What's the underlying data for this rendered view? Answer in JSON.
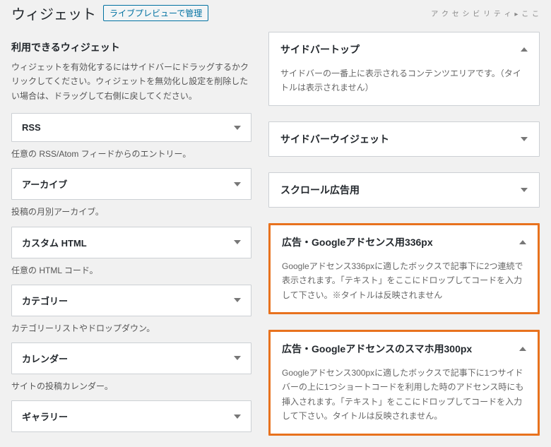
{
  "header": {
    "title": "ウィジェット",
    "manage_button": "ライブプレビューで管理",
    "top_right": "ア ク セ シ ビ リ テ ィ  ▸  こ こ"
  },
  "left": {
    "heading": "利用できるウィジェット",
    "help": "ウィジェットを有効化するにはサイドバーにドラッグするかクリックしてください。ウィジェットを無効化し設定を削除したい場合は、ドラッグして右側に戻してください。",
    "widgets": [
      {
        "title": "RSS",
        "desc": "任意の RSS/Atom フィードからのエントリー。"
      },
      {
        "title": "アーカイブ",
        "desc": "投稿の月別アーカイブ。"
      },
      {
        "title": "カスタム HTML",
        "desc": "任意の HTML コード。"
      },
      {
        "title": "カテゴリー",
        "desc": "カテゴリーリストやドロップダウン。"
      },
      {
        "title": "カレンダー",
        "desc": "サイトの投稿カレンダー。"
      },
      {
        "title": "ギャラリー",
        "desc": ""
      }
    ]
  },
  "right": {
    "areas": [
      {
        "title": "サイドバートップ",
        "arrow": "up",
        "body": "サイドバーの一番上に表示されるコンテンツエリアです。（タイトルは表示されません）",
        "highlight": false
      },
      {
        "title": "サイドバーウイジェット",
        "arrow": "down",
        "body": "",
        "highlight": false
      },
      {
        "title": "スクロール広告用",
        "arrow": "down",
        "body": "",
        "highlight": false
      },
      {
        "title": "広告・Googleアドセンス用336px",
        "arrow": "up",
        "body": "Googleアドセンス336pxに適したボックスで記事下に2つ連続で表示されます。「テキスト」をここにドロップしてコードを入力して下さい。※タイトルは反映されません",
        "highlight": true
      },
      {
        "title": "広告・Googleアドセンスのスマホ用300px",
        "arrow": "up",
        "body": "Googleアドセンス300pxに適したボックスで記事下に1つサイドバーの上に1つショートコードを利用した時のアドセンス時にも挿入されます。「テキスト」をここにドロップしてコードを入力して下さい。タイトルは反映されません。",
        "highlight": true
      }
    ]
  }
}
